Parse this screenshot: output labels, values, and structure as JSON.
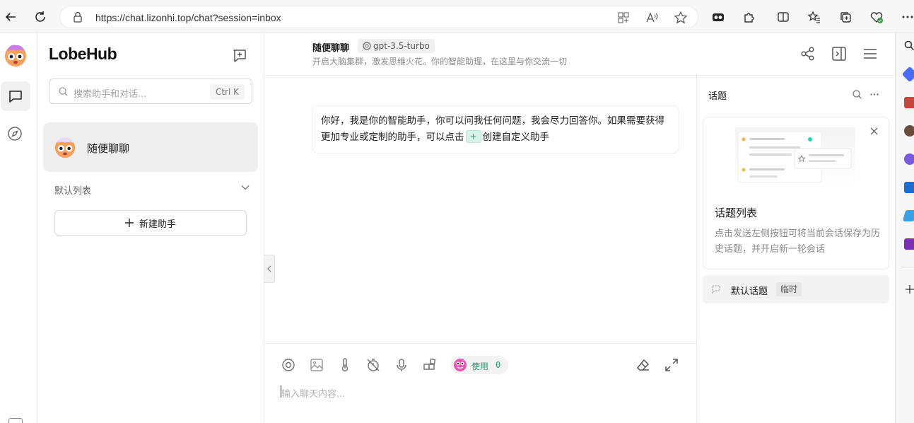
{
  "browser": {
    "url": "https://chat.lizonhi.top/chat?session=inbox"
  },
  "sidebar": {
    "brand": "LobeHub",
    "search_placeholder": "搜索助手和对话...",
    "search_shortcut": "Ctrl K",
    "session_name": "随便聊聊",
    "group_label": "默认列表",
    "new_assistant_label": "新建助手"
  },
  "chat": {
    "title": "随便聊聊",
    "model": "gpt-3.5-turbo",
    "description": "开启大脑集群，激发思维火花。你的智能助理，在这里与你交流一切",
    "message_part1": "你好，我是你的智能助手，你可以问我任何问题，我会尽力回答你。如果需要获得更加专业或定制的助手，可以点击",
    "message_plus": "+",
    "message_part2": "创建自定义助手",
    "token_label": "使用",
    "token_count": "0",
    "input_placeholder": "输入聊天内容..."
  },
  "topics": {
    "heading": "话题",
    "card_title": "话题列表",
    "card_desc": "点击发送左侧按钮可将当前会话保存为历史话题，并开启新一轮会话",
    "default_topic": "默认话题",
    "temp_badge": "临时"
  },
  "colors": {
    "accent": "#2c9c7a",
    "selected_bg": "#efefef"
  }
}
